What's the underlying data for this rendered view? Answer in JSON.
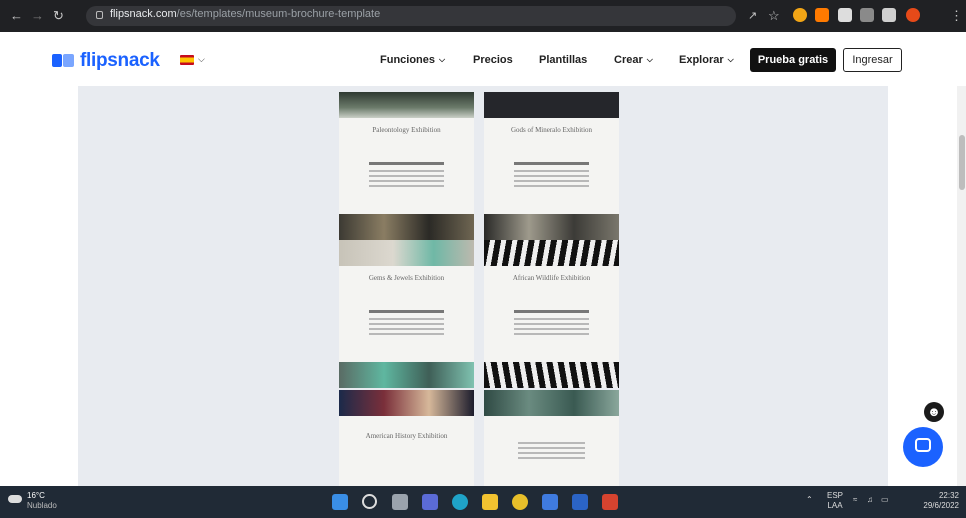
{
  "browser": {
    "url_host": "flipsnack.com",
    "url_path": "/es/templates/museum-brochure-template"
  },
  "site": {
    "logo_text": "flipsnack",
    "nav": [
      {
        "label": "Funciones",
        "has_dropdown": true
      },
      {
        "label": "Precios",
        "has_dropdown": false
      },
      {
        "label": "Plantillas",
        "has_dropdown": false
      },
      {
        "label": "Crear",
        "has_dropdown": true
      },
      {
        "label": "Explorar",
        "has_dropdown": true
      }
    ],
    "cta_label": "Prueba gratis",
    "login_label": "Ingresar"
  },
  "templates": [
    {
      "title": "Paleontology Exhibition"
    },
    {
      "title": "Gods of Mineralo Exhibition"
    },
    {
      "title": "Gems & Jewels Exhibition"
    },
    {
      "title": "African Wildlife Exhibition"
    },
    {
      "title": "American History Exhibition"
    },
    {
      "title": ""
    }
  ],
  "taskbar": {
    "weather_temp": "16°C",
    "weather_desc": "Nublado",
    "lang_top": "ESP",
    "lang_bottom": "LAA",
    "time": "22:32",
    "date": "29/6/2022"
  },
  "colors": {
    "brand": "#1b62ff",
    "content_bg": "#e8ebf0"
  }
}
